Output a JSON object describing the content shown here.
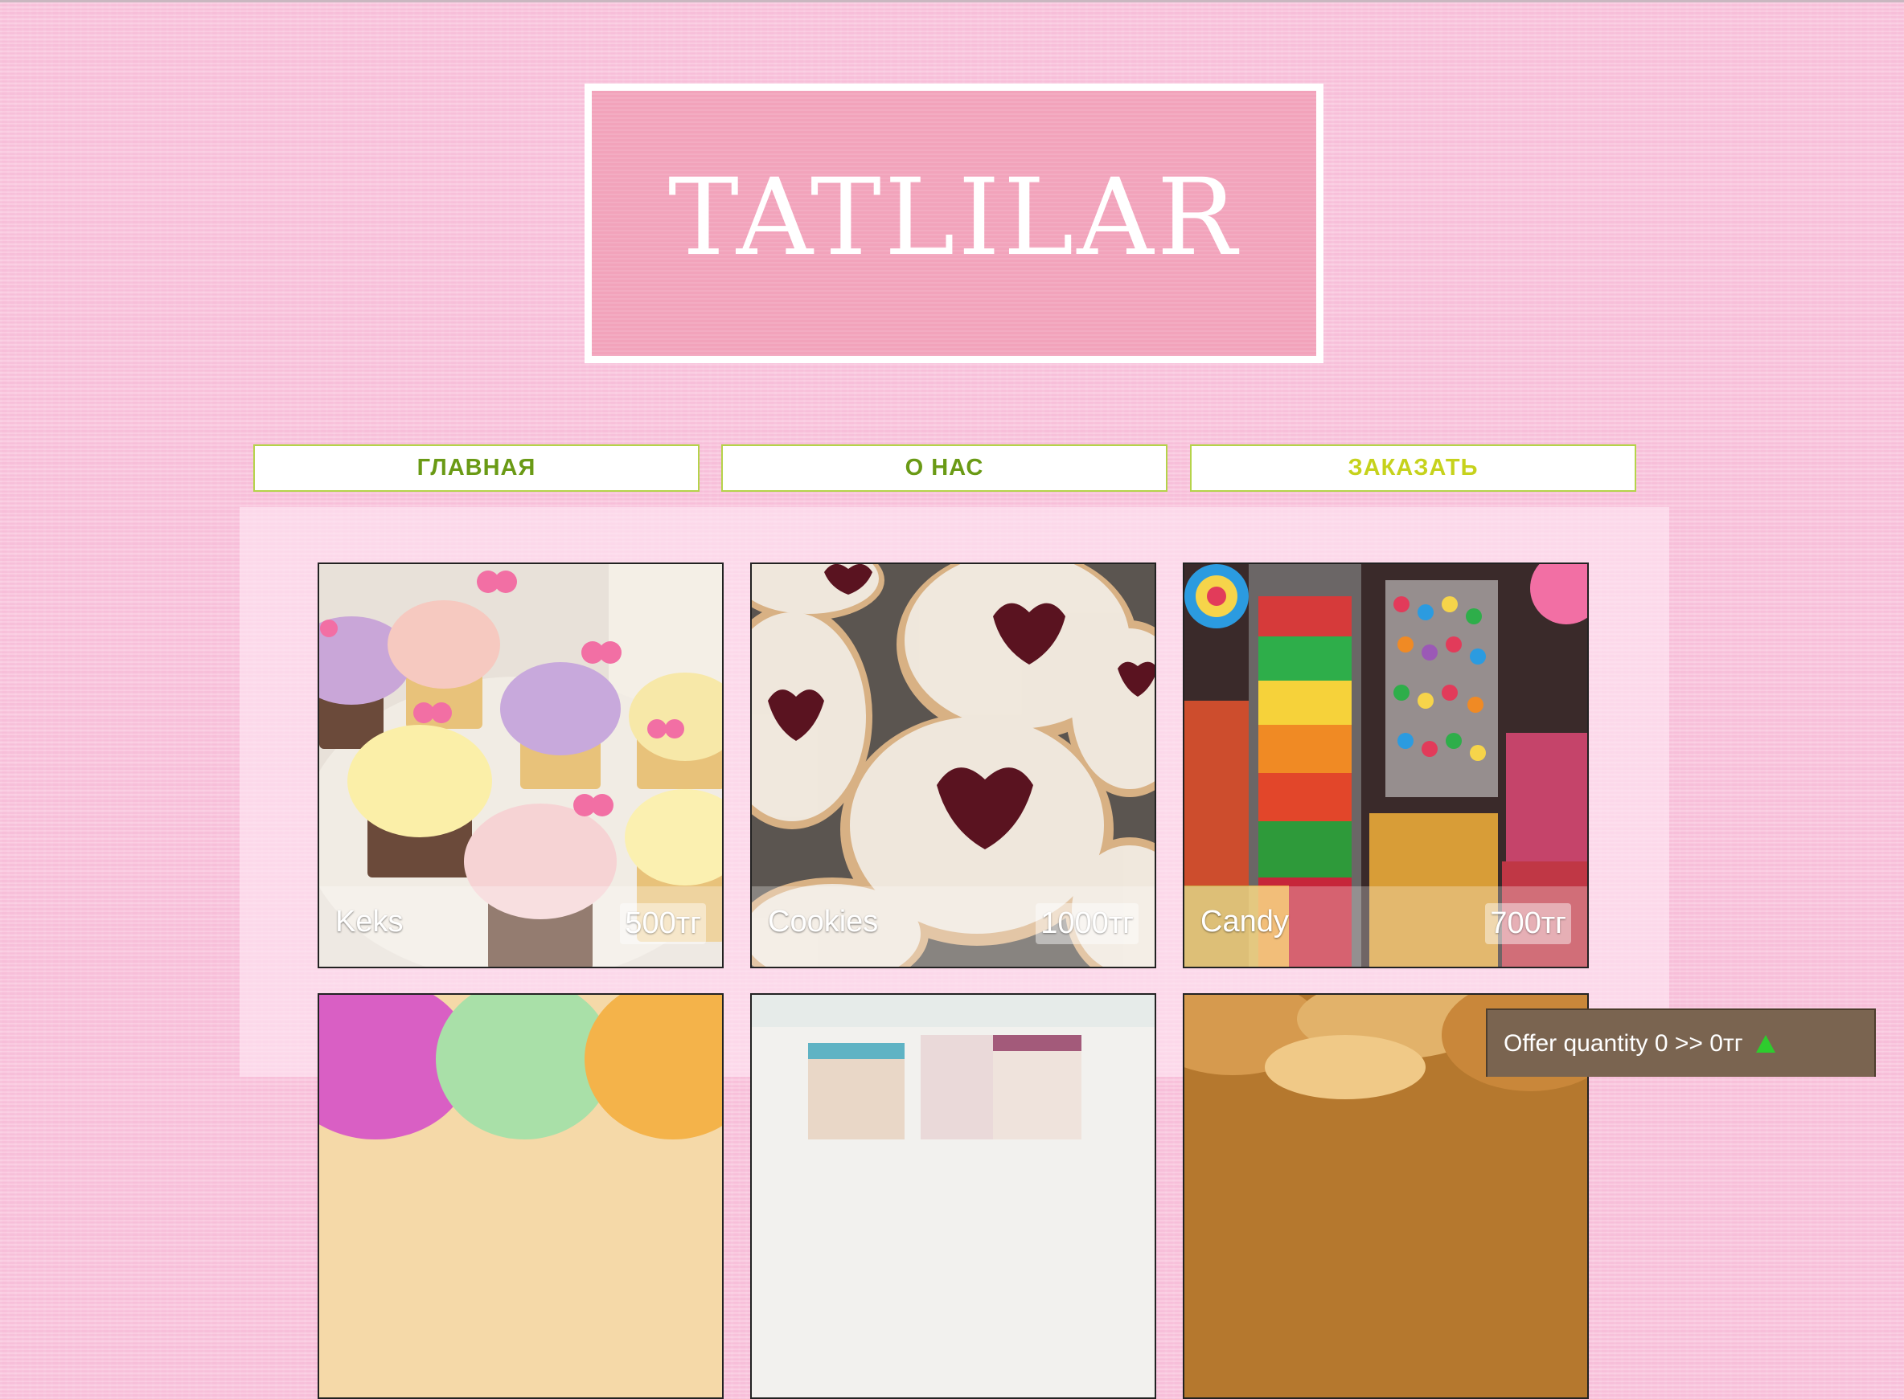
{
  "logo": {
    "text": "TATLILAR"
  },
  "nav": {
    "items": [
      {
        "label": "ГЛАВНАЯ",
        "color": "#6a9a15"
      },
      {
        "label": "О НАС",
        "color": "#6a9a15"
      },
      {
        "label": "ЗАКАЗАТЬ",
        "color": "#c6d21c"
      }
    ]
  },
  "products": [
    {
      "name": "Keks",
      "price": "500тг",
      "image": "cupcakes"
    },
    {
      "name": "Cookies",
      "price": "1000тг",
      "image": "linzer-heart-cookies"
    },
    {
      "name": "Candy",
      "price": "700тг",
      "image": "candy-jars"
    },
    {
      "name": "",
      "price": "",
      "image": "ice-cream-scoops"
    },
    {
      "name": "",
      "price": "",
      "image": "gift-boxes"
    },
    {
      "name": "",
      "price": "",
      "image": "pastries"
    }
  ],
  "offer": {
    "text": "Offer quantity 0 >> 0тг",
    "icon": "triangle-up-icon"
  },
  "colors": {
    "background": "#f9c3dc",
    "logo_box": "#f2a3bb",
    "nav_border": "#b5d34a",
    "offer_bar": "#7a6450"
  }
}
